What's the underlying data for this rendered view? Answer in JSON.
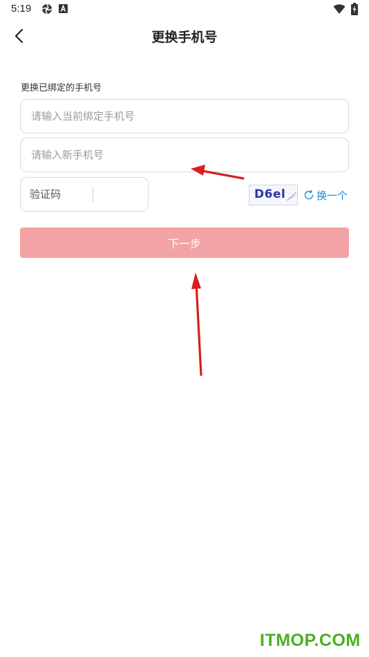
{
  "status_bar": {
    "time": "5:19",
    "icons": [
      "app-icon",
      "a-box-icon",
      "wifi-icon",
      "battery-charging-icon"
    ]
  },
  "header": {
    "back_icon": "chevron-left-icon",
    "title": "更换手机号"
  },
  "form": {
    "section_label": "更换已绑定的手机号",
    "current_phone": {
      "value": "",
      "placeholder": "请输入当前绑定手机号"
    },
    "new_phone": {
      "value": "",
      "placeholder": "请输入新手机号"
    },
    "captcha_input": {
      "value": "",
      "placeholder": "验证码"
    },
    "captcha_image_text": "D6el",
    "refresh_label": "换一个",
    "refresh_icon": "refresh-icon",
    "next_button": "下一步"
  },
  "colors": {
    "accent_button": "#f1a3a5",
    "link": "#1e8ad8",
    "annotation_arrow": "#d81e1e",
    "watermark": "#4caf22"
  },
  "watermark": "ITMOP.COM"
}
